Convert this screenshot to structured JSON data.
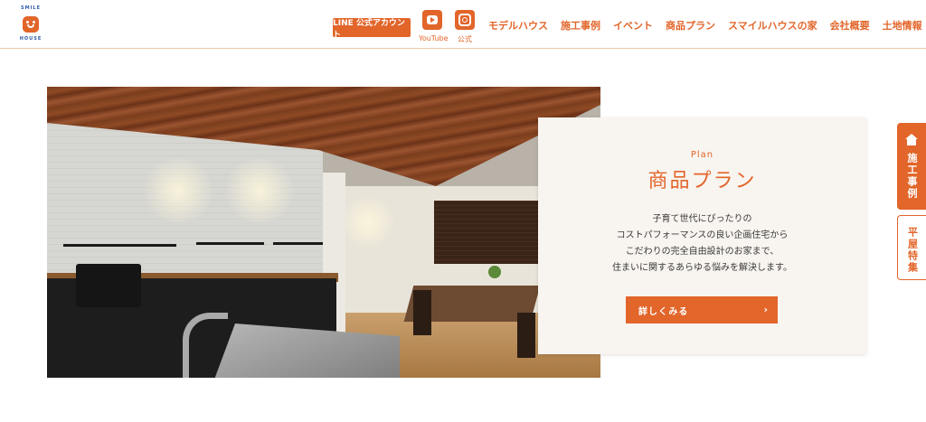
{
  "header": {
    "logo": {
      "top_text": "SMILE",
      "bottom_text": "HOUSE",
      "brand_color": "#e2652a",
      "text_color": "#2f5aa8"
    },
    "line_button": "LINE 公式アカウント",
    "sns": [
      {
        "icon": "youtube-icon",
        "label": "YouTube"
      },
      {
        "icon": "instagram-icon",
        "label": "公式"
      }
    ],
    "nav": [
      "モデルハウス",
      "施工事例",
      "イベント",
      "商品プラン",
      "スマイルハウスの家",
      "会社概要",
      "土地情報"
    ]
  },
  "card": {
    "eyebrow": "Plan",
    "title": "商品プラン",
    "body": [
      "子育て世代にぴったりの",
      "コストパフォーマンスの良い企画住宅から",
      "こだわりの完全自由設計のお家まで、",
      "住まいに関するあらゆる悩みを解決します。"
    ],
    "cta_label": "詳しくみる",
    "cta_icon": "chevron-right-icon"
  },
  "side_tabs": [
    {
      "icon": "house-icon",
      "label": "施工事例"
    },
    {
      "label": "平屋特集"
    }
  ],
  "colors": {
    "accent": "#e2652a",
    "card_bg": "#f8f4ef"
  }
}
